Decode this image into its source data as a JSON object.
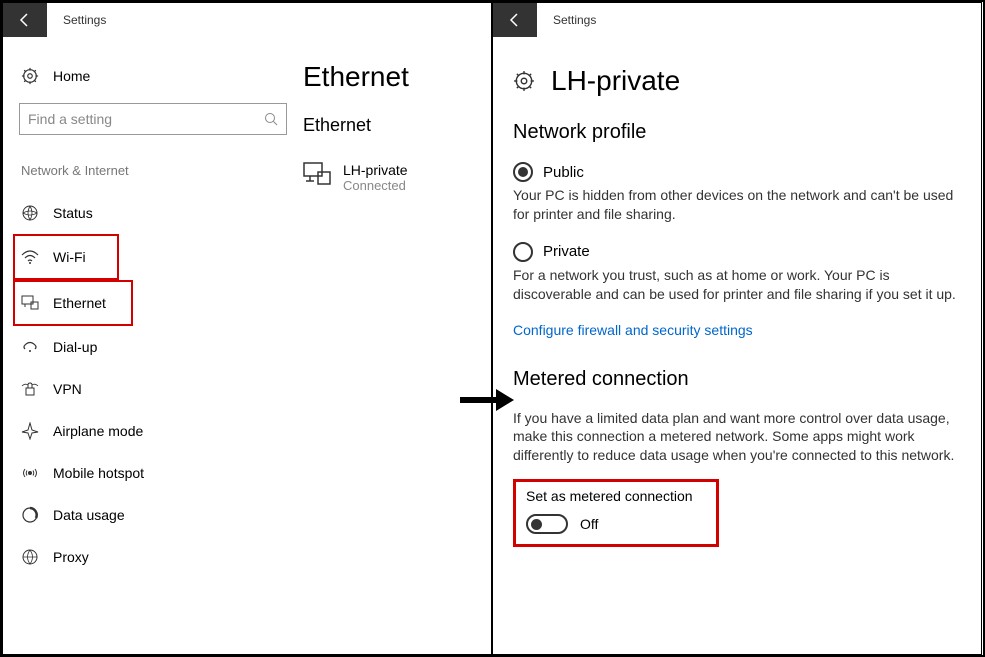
{
  "leftPanel": {
    "headerTitle": "Settings",
    "homeLabel": "Home",
    "searchPlaceholder": "Find a setting",
    "categoryLabel": "Network & Internet",
    "navItems": {
      "status": "Status",
      "wifi": "Wi-Fi",
      "ethernet": "Ethernet",
      "dialup": "Dial-up",
      "vpn": "VPN",
      "airplane": "Airplane mode",
      "hotspot": "Mobile hotspot",
      "datausage": "Data usage",
      "proxy": "Proxy"
    },
    "content": {
      "pageTitle": "Ethernet",
      "subTitle": "Ethernet",
      "networkName": "LH-private",
      "networkStatus": "Connected"
    }
  },
  "rightPanel": {
    "headerTitle": "Settings",
    "pageTitle": "LH-private",
    "section1": {
      "heading": "Network profile",
      "publicLabel": "Public",
      "publicDesc": "Your PC is hidden from other devices on the network and can't be used for printer and file sharing.",
      "privateLabel": "Private",
      "privateDesc": "For a network you trust, such as at home or work. Your PC is discoverable and can be used for printer and file sharing if you set it up.",
      "configureLink": "Configure firewall and security settings"
    },
    "section2": {
      "heading": "Metered connection",
      "desc": "If you have a limited data plan and want more control over data usage, make this connection a metered network. Some apps might work differently to reduce data usage when you're connected to this network.",
      "toggleLabel": "Set as metered connection",
      "toggleState": "Off"
    }
  }
}
